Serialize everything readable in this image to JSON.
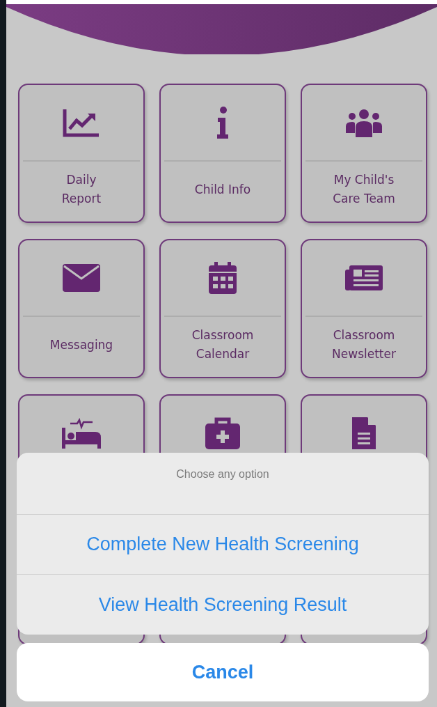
{
  "tiles": [
    {
      "kind": "chart",
      "label": "Daily\nReport"
    },
    {
      "kind": "info",
      "label": "Child Info"
    },
    {
      "kind": "team",
      "label": "My Child's\nCare Team"
    },
    {
      "kind": "mail",
      "label": "Messaging"
    },
    {
      "kind": "calendar",
      "label": "Classroom\nCalendar"
    },
    {
      "kind": "newspaper",
      "label": "Classroom\nNewsletter"
    },
    {
      "kind": "bed"
    },
    {
      "kind": "medkit"
    },
    {
      "kind": "document"
    }
  ],
  "action_sheet": {
    "title": "Choose any option",
    "options": [
      "Complete New Health Screening",
      "View Health Screening Result"
    ],
    "cancel": "Cancel"
  }
}
